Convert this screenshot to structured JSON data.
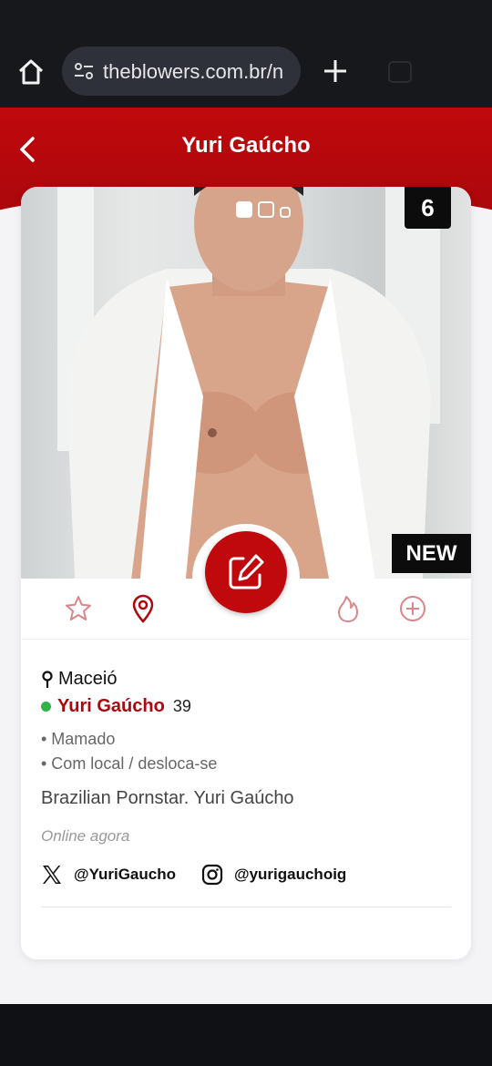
{
  "browser": {
    "url": "theblowers.com.br/n",
    "icons": [
      "home-icon",
      "site-settings-icon",
      "plus-icon",
      "tabs-icon"
    ]
  },
  "header": {
    "title": "Yuri Gaúcho",
    "back_icon": "chevron-left-icon",
    "color": "#c0090d"
  },
  "photo": {
    "count": "6",
    "badge": "NEW",
    "carousel_dots": 3,
    "active_dot": 0
  },
  "actions": {
    "icons": [
      "star-icon",
      "map-pin-icon",
      "edit-icon",
      "flame-icon",
      "plus-circle-icon"
    ]
  },
  "profile": {
    "city": "Maceió",
    "name": "Yuri Gaúcho",
    "age": "39",
    "tags": [
      "• Mamado",
      "• Com local / desloca-se"
    ],
    "bio": "Brazilian Pornstar. Yuri Gaúcho",
    "status": "Online agora",
    "online_color": "#2fb34a",
    "socials": {
      "x_handle": "@YuriGaucho",
      "instagram_handle": "@yurigauchoig"
    }
  }
}
